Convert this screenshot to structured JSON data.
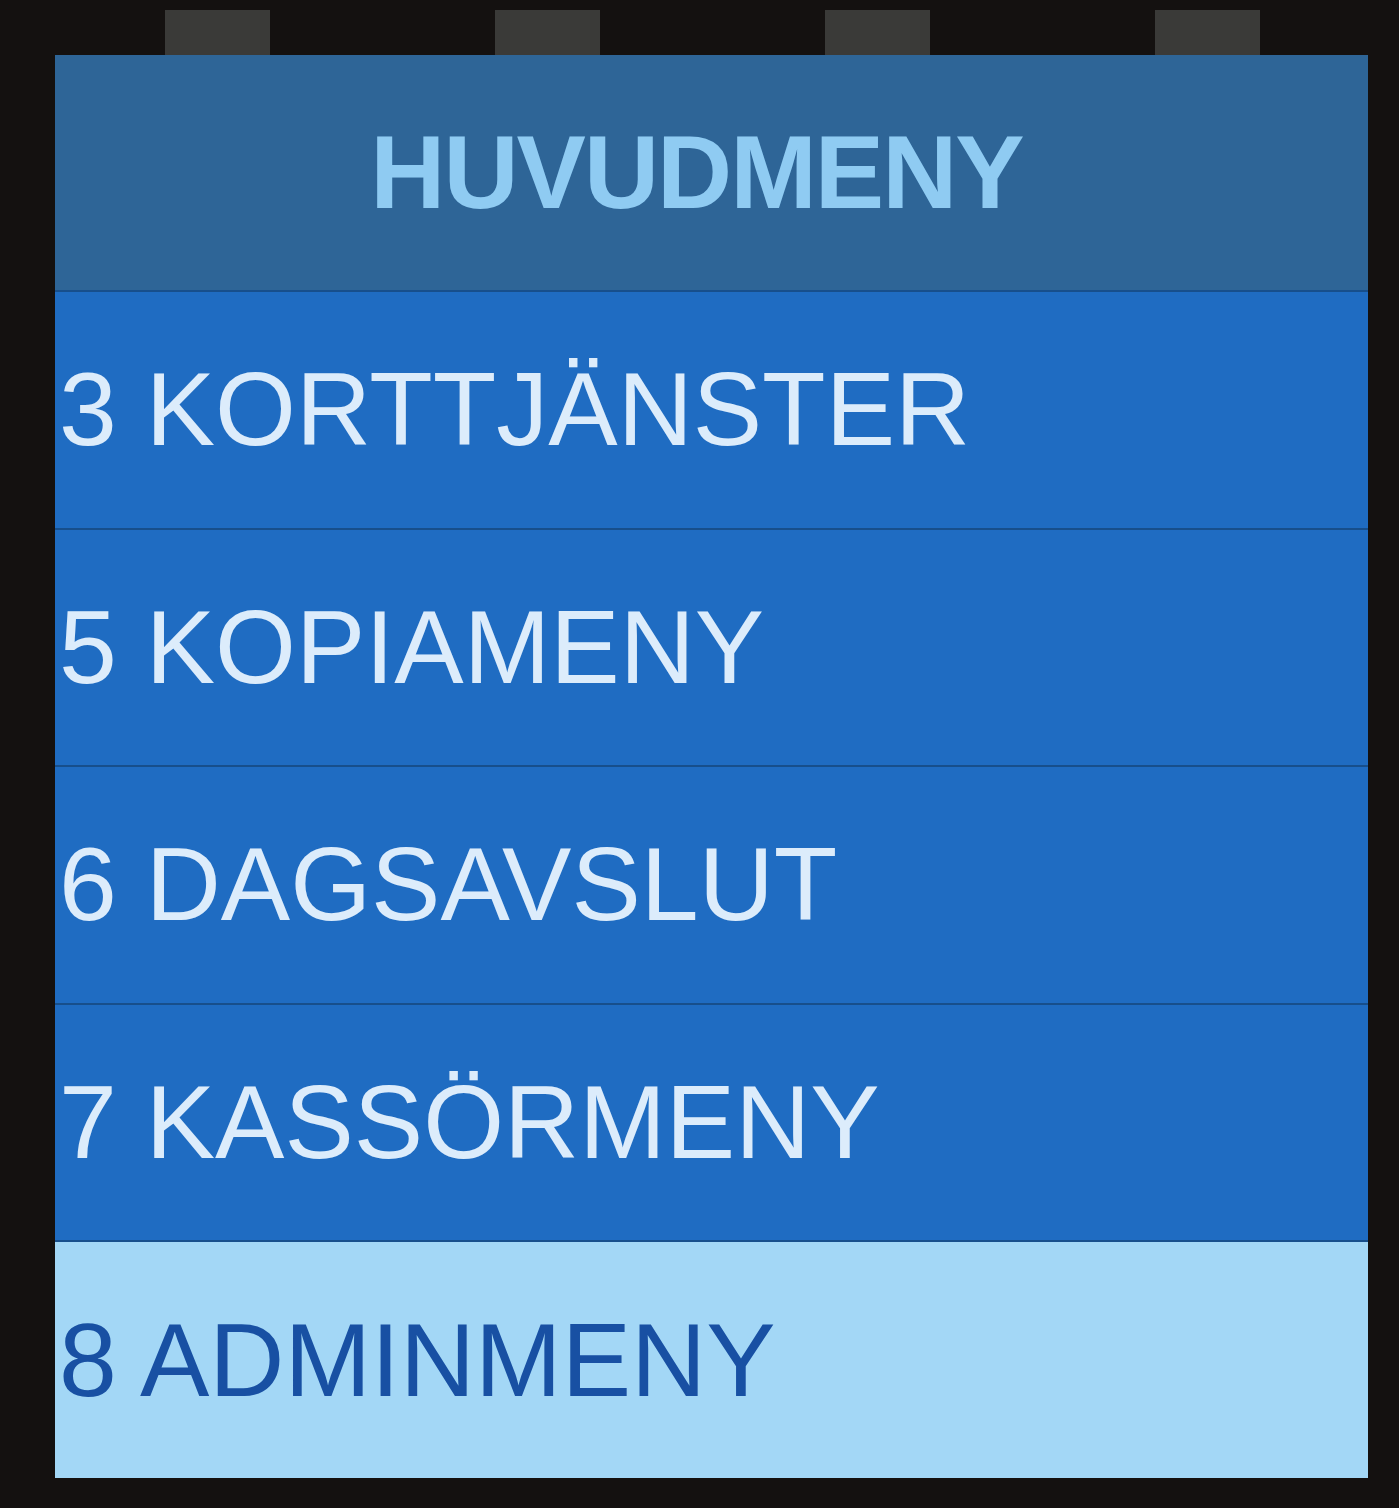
{
  "header": {
    "title": "HUVUDMENY"
  },
  "menu": {
    "items": [
      {
        "label": "3 KORTTJÄNSTER",
        "selected": false
      },
      {
        "label": "5 KOPIAMENY",
        "selected": false
      },
      {
        "label": "6 DAGSAVSLUT",
        "selected": false
      },
      {
        "label": "7 KASSÖRMENY",
        "selected": false
      },
      {
        "label": "8 ADMINMENY",
        "selected": true
      }
    ]
  }
}
